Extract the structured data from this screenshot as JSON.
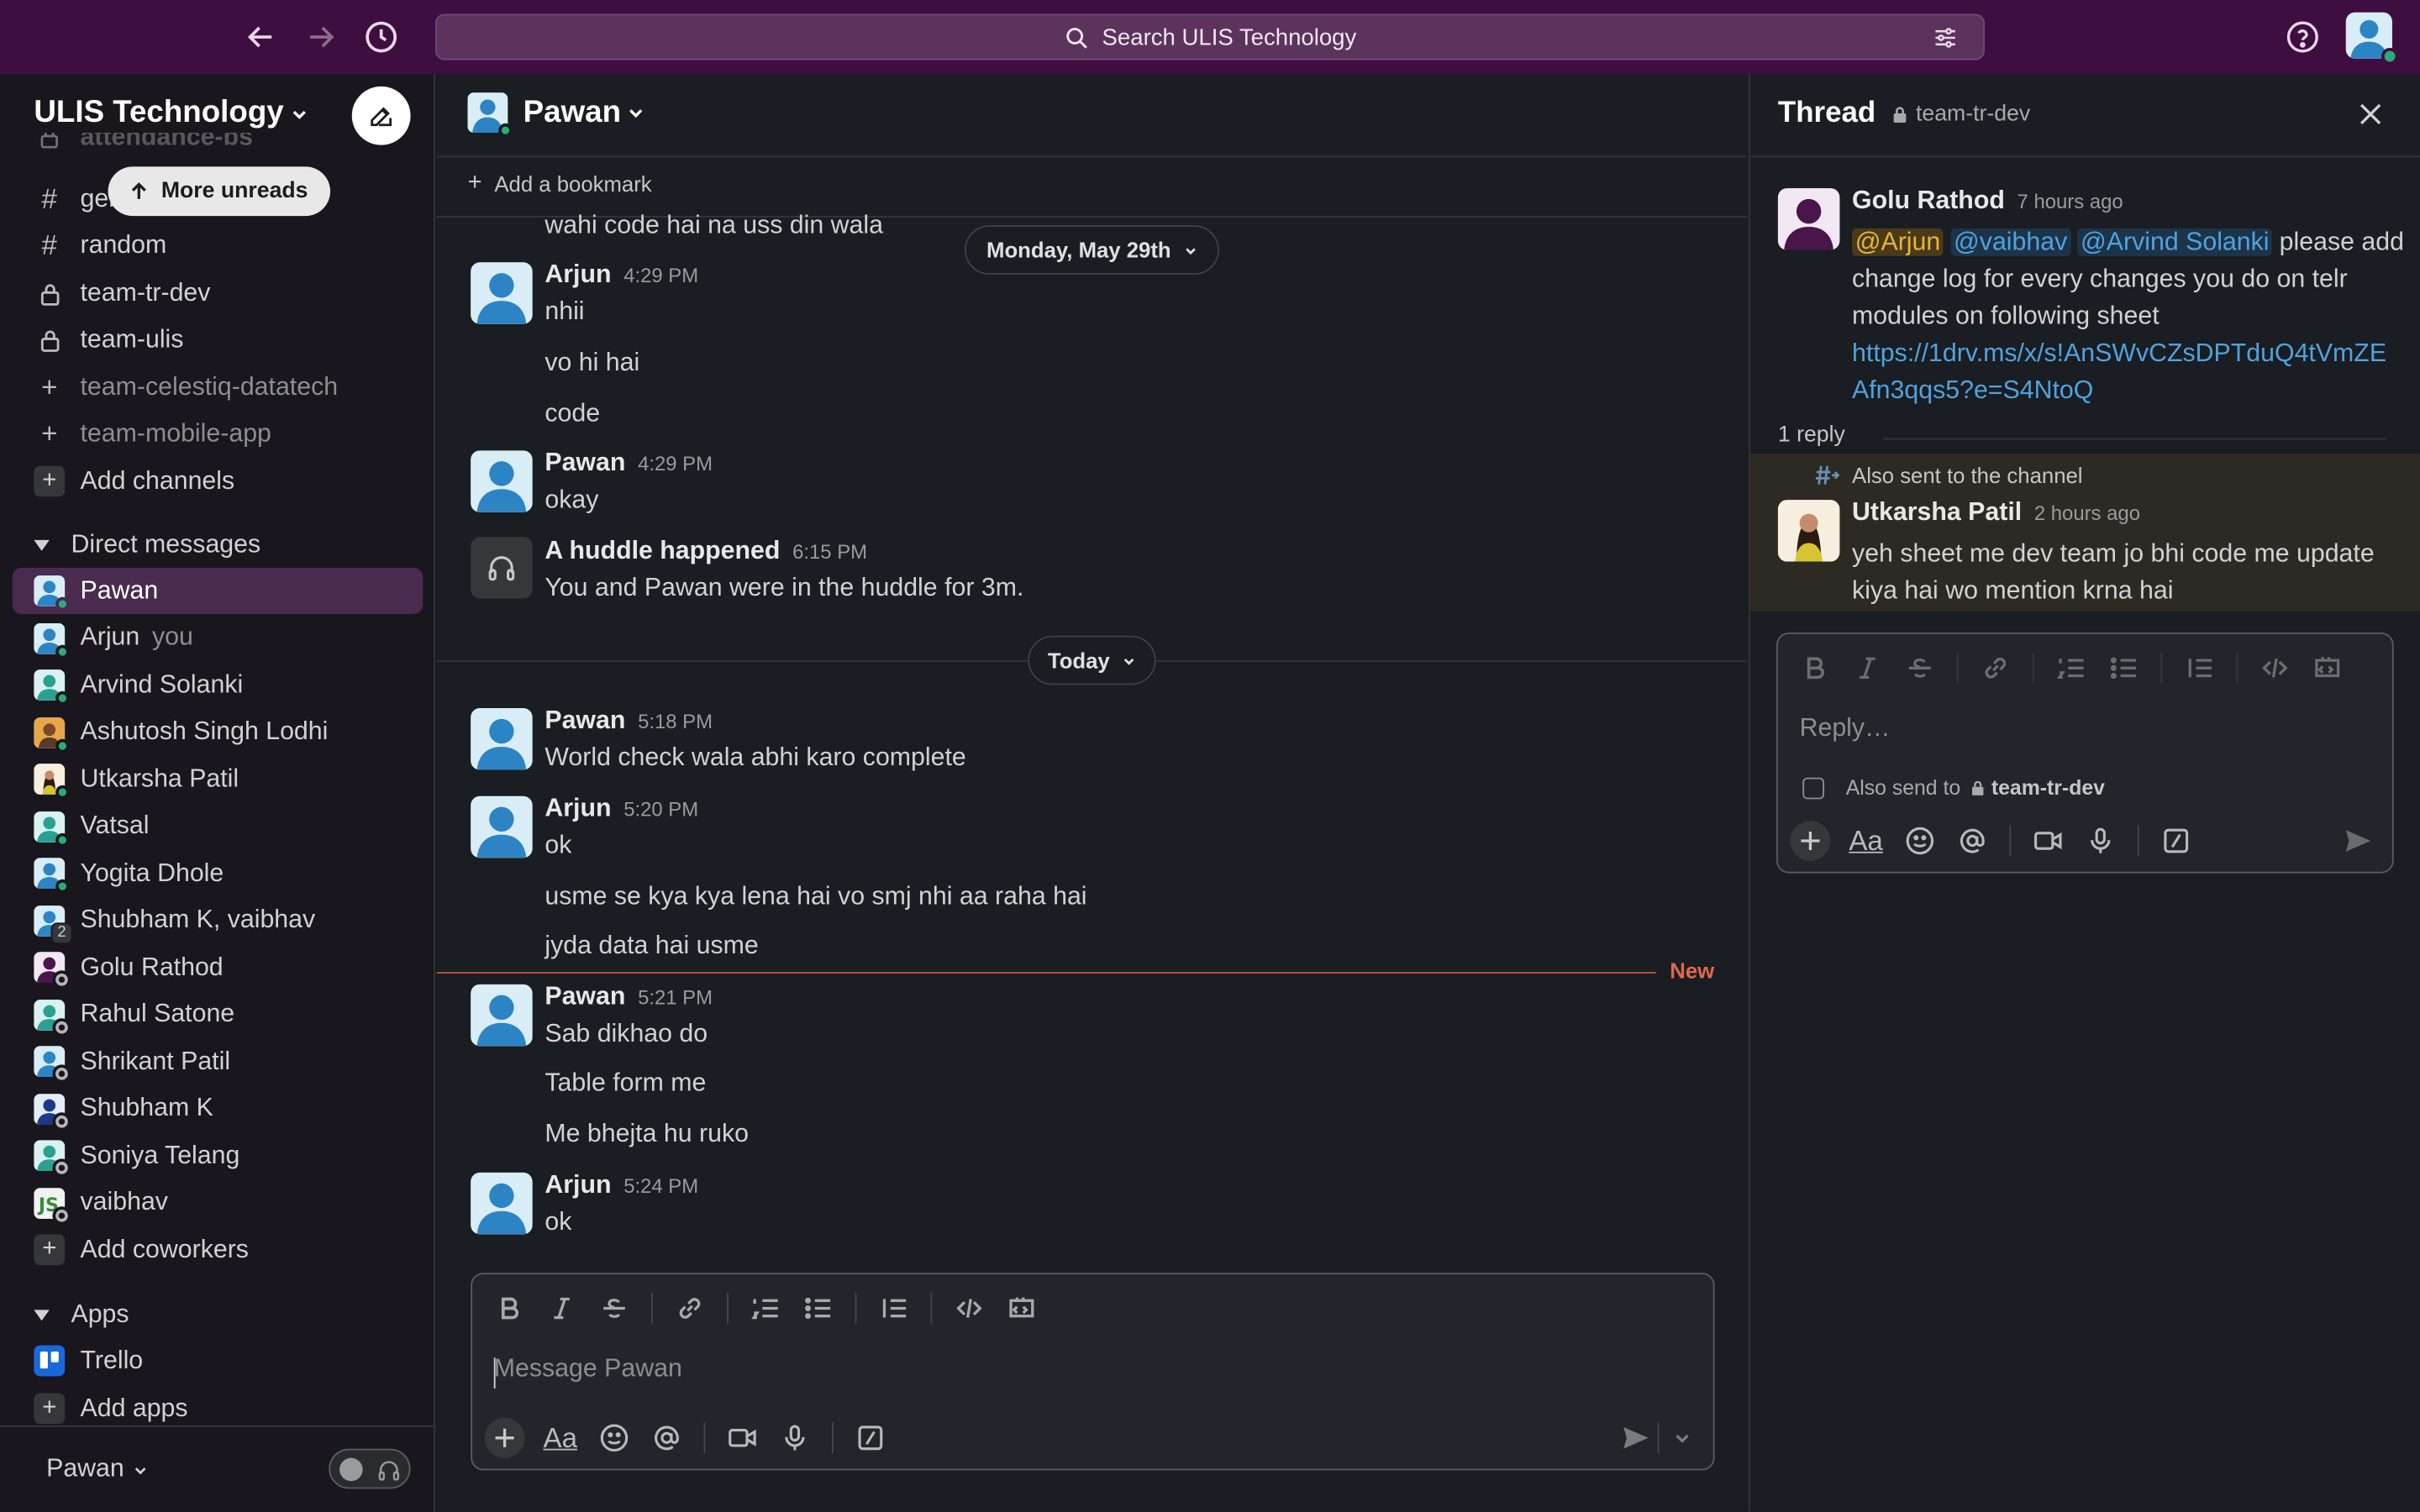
{
  "search": {
    "placeholder": "Search ULIS Technology"
  },
  "sidebar": {
    "workspace": "ULIS Technology",
    "more_unreads": "More unreads",
    "partial_channel": "attendance-bs",
    "channels": [
      {
        "label": "general",
        "type": "hash"
      },
      {
        "label": "random",
        "type": "hash"
      },
      {
        "label": "team-tr-dev",
        "type": "lock"
      },
      {
        "label": "team-ulis",
        "type": "lock"
      },
      {
        "label": "team-celestiq-datatech",
        "type": "plus"
      },
      {
        "label": "team-mobile-app",
        "type": "plus"
      }
    ],
    "add_channels": "Add channels",
    "dm_header": "Direct messages",
    "dms": [
      {
        "name": "Pawan",
        "status": "on"
      },
      {
        "name": "Arjun",
        "status": "on",
        "you": "you"
      },
      {
        "name": "Arvind Solanki",
        "status": "on"
      },
      {
        "name": "Ashutosh Singh Lodhi",
        "status": "on"
      },
      {
        "name": "Utkarsha Patil",
        "status": "on"
      },
      {
        "name": "Vatsal",
        "status": "on"
      },
      {
        "name": "Yogita Dhole",
        "status": "on"
      },
      {
        "name": "Shubham K, vaibhav",
        "status": "group",
        "count": "2"
      },
      {
        "name": "Golu Rathod",
        "status": "off"
      },
      {
        "name": "Rahul Satone",
        "status": "off"
      },
      {
        "name": "Shrikant Patil",
        "status": "off"
      },
      {
        "name": "Shubham K",
        "status": "off"
      },
      {
        "name": "Soniya Telang",
        "status": "off"
      },
      {
        "name": "vaibhav",
        "status": "off"
      }
    ],
    "add_coworkers": "Add coworkers",
    "apps_header": "Apps",
    "apps": [
      {
        "name": "Trello"
      }
    ],
    "add_apps": "Add apps",
    "footer_user": "Pawan"
  },
  "channel": {
    "title": "Pawan",
    "bookmark": "Add a bookmark",
    "day1": "Monday, May 29th",
    "day2": "Today",
    "new_label": "New",
    "partial_line": "wahi code hai na uss din wala",
    "messages": [
      {
        "name": "Arjun",
        "time": "4:29 PM",
        "lines": [
          "nhii",
          "vo hi hai",
          "code"
        ]
      },
      {
        "name": "Pawan",
        "time": "4:29 PM",
        "lines": [
          "okay"
        ]
      },
      {
        "name": "A huddle happened",
        "time": "6:15 PM",
        "lines": [
          "You and Pawan were in the huddle for 3m."
        ]
      },
      {
        "name": "Pawan",
        "time": "5:18 PM",
        "lines": [
          "World check wala abhi karo complete"
        ]
      },
      {
        "name": "Arjun",
        "time": "5:20 PM",
        "lines": [
          "ok",
          "usme se kya kya lena hai vo smj nhi aa raha hai",
          "jyda data hai usme"
        ]
      },
      {
        "name": "Pawan",
        "time": "5:21 PM",
        "lines": [
          "Sab dikhao do",
          "Table form me",
          "Me bhejta hu ruko"
        ]
      },
      {
        "name": "Arjun",
        "time": "5:24 PM",
        "lines": [
          "ok"
        ]
      }
    ],
    "composer_placeholder": "Message Pawan"
  },
  "thread": {
    "title": "Thread",
    "channel": "team-tr-dev",
    "parent": {
      "name": "Golu Rathod",
      "time": "7 hours ago",
      "mentions": [
        "@Arjun",
        "@vaibhav",
        "@Arvind Solanki"
      ],
      "text1": "please add",
      "text2": "change log for every changes you do on telr",
      "text3": "modules on following sheet",
      "link1": "https://1drv.ms/x/s!AnSWvCZsDPTduQ4tVmZE",
      "link2": "Afn3qqs5?e=S4NtoQ"
    },
    "reply_count": "1 reply",
    "also_sent": "Also sent to the channel",
    "reply": {
      "name": "Utkarsha Patil",
      "time": "2 hours ago",
      "line1": "yeh sheet me dev team jo bhi code me update",
      "line2": "kiya hai wo mention krna hai"
    },
    "reply_placeholder": "Reply…",
    "also_send_to": "Also send to",
    "also_send_channel": "team-tr-dev"
  },
  "colors": {
    "topbar": "#3f0e40",
    "sidebar": "#19171d",
    "active": "#4a2a4f",
    "online": "#2bac76",
    "new_line": "#c0533a",
    "link": "#4fa3e0"
  }
}
